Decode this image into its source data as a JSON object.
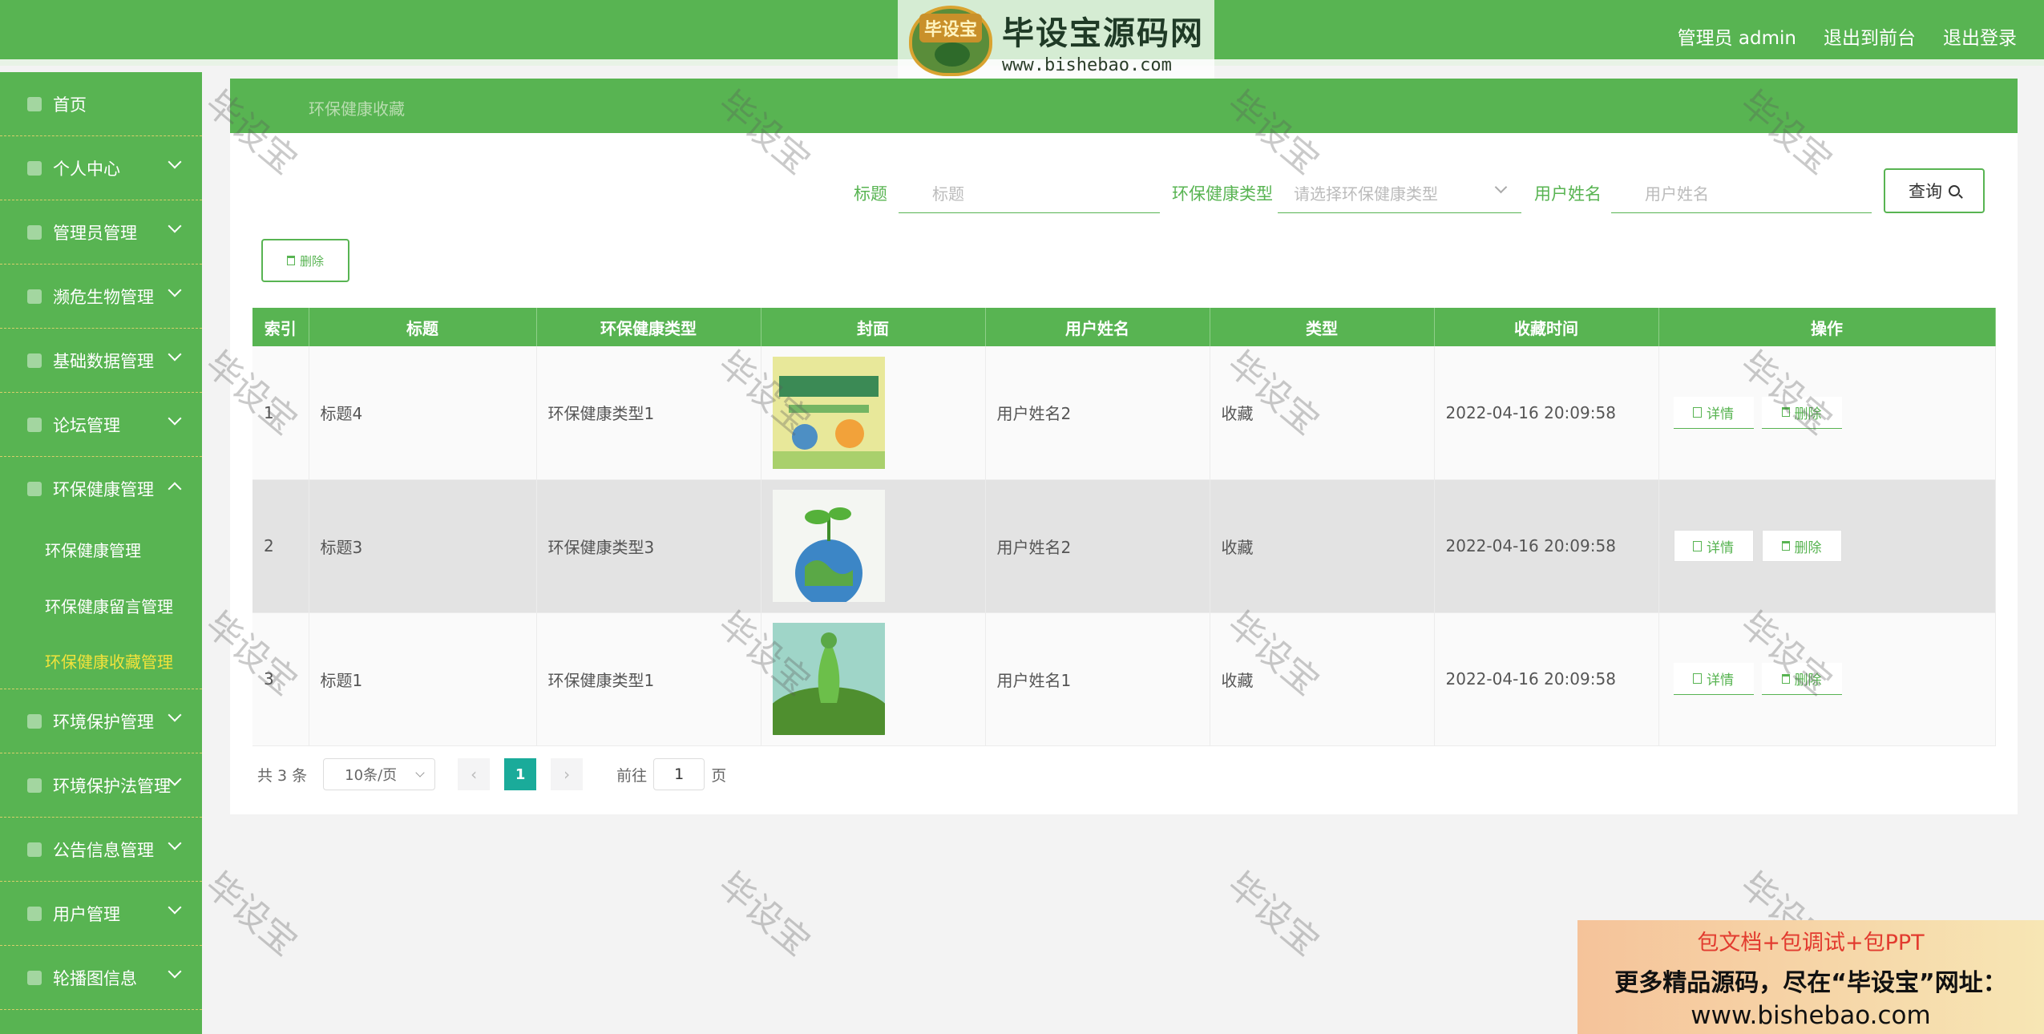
{
  "header": {
    "logo_title": "毕设宝源码网",
    "logo_badge": "毕设宝",
    "logo_url": "www.bishebao.com",
    "admin_label": "管理员 admin",
    "front_link": "退出到前台",
    "logout_link": "退出登录",
    "color": "#58b452"
  },
  "sidebar": {
    "home": "首页",
    "items": [
      "个人中心",
      "管理员管理",
      "濒危生物管理",
      "基础数据管理",
      "论坛管理",
      "环保健康管理"
    ],
    "subitems": [
      "环保健康管理",
      "环保健康留言管理",
      "环保健康收藏管理"
    ],
    "items_after": [
      "环境保护管理",
      "环境保护法管理",
      "公告信息管理",
      "用户管理",
      "轮播图信息"
    ],
    "active_color": "#f3e33b"
  },
  "breadcrumb": "环保健康收藏",
  "search": {
    "title_label": "标题",
    "title_placeholder": "标题",
    "type_label": "环保健康类型",
    "type_placeholder": "请选择环保健康类型",
    "user_label": "用户姓名",
    "user_placeholder": "用户姓名",
    "query_button": "查询"
  },
  "toolbar": {
    "delete_label": "删除"
  },
  "table": {
    "headers": [
      "索引",
      "标题",
      "环保健康类型",
      "封面",
      "用户姓名",
      "类型",
      "收藏时间",
      "操作"
    ],
    "rows": [
      {
        "index": "1",
        "title": "标题4",
        "type": "环保健康类型1",
        "cover": "poster-icon",
        "user": "用户姓名2",
        "kind": "收藏",
        "time": "2022-04-16 20:09:58",
        "detail": "详情",
        "delete": "删除"
      },
      {
        "index": "2",
        "title": "标题3",
        "type": "环保健康类型3",
        "cover": "earth-sprout-icon",
        "user": "用户姓名2",
        "kind": "收藏",
        "time": "2022-04-16 20:09:58",
        "detail": "详情",
        "delete": "删除"
      },
      {
        "index": "3",
        "title": "标题1",
        "type": "环保健康类型1",
        "cover": "green-earth-icon",
        "user": "用户姓名1",
        "kind": "收藏",
        "time": "2022-04-16 20:09:58",
        "detail": "详情",
        "delete": "删除"
      }
    ]
  },
  "pager": {
    "total": "共 3 条",
    "page_size": "10条/页",
    "current_page": "1",
    "goto_prefix": "前往",
    "goto_value": "1",
    "goto_suffix": "页"
  },
  "watermark": "毕设宝",
  "ad": {
    "line1": "包文档+包调试+包PPT",
    "line2": "更多精品源码，尽在“毕设宝”网址：",
    "line3": "www.bishebao.com"
  }
}
